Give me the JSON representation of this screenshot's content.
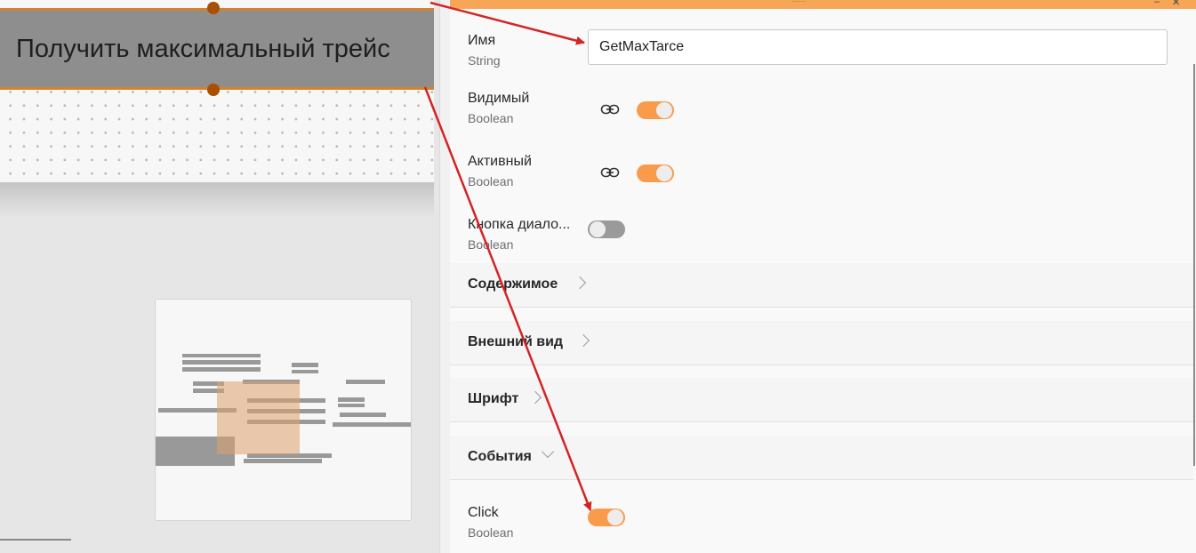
{
  "canvas": {
    "selected_button_text": "Получить максимальный трейс"
  },
  "panel": {
    "window_title": "......",
    "minimize_glyph": "–",
    "close_glyph": "✕",
    "properties": [
      {
        "label": "Имя",
        "type": "String",
        "value": "GetMaxTarce"
      },
      {
        "label": "Видимый",
        "type": "Boolean",
        "bound": true,
        "state": "on"
      },
      {
        "label": "Активный",
        "type": "Boolean",
        "bound": true,
        "state": "on"
      },
      {
        "label": "Кнопка диало...",
        "type": "Boolean",
        "bound": false,
        "state": "off"
      }
    ],
    "sections": [
      {
        "label": "Содержимое",
        "expanded": false
      },
      {
        "label": "Внешний вид",
        "expanded": false
      },
      {
        "label": "Шрифт",
        "expanded": false
      },
      {
        "label": "События",
        "expanded": true
      }
    ],
    "events": [
      {
        "label": "Click",
        "type": "Boolean",
        "state": "on"
      }
    ]
  },
  "colors": {
    "accent": "#fa9a4b",
    "selection_border": "#d4822f",
    "annotation_arrow": "#d42424"
  },
  "icons": [
    "link-icon",
    "chevron-right-icon",
    "chevron-down-icon",
    "close-icon",
    "minimize-icon"
  ]
}
